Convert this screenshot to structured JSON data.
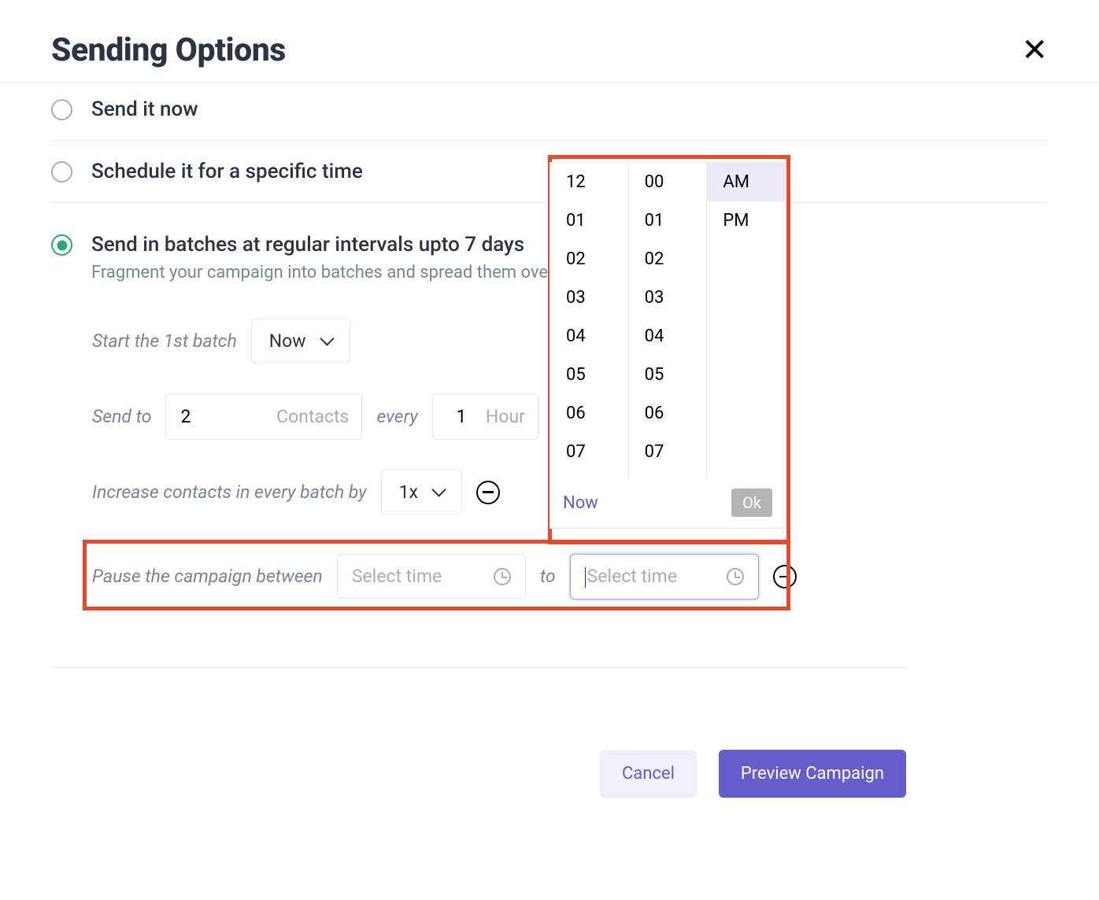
{
  "header": {
    "title": "Sending Options"
  },
  "options": {
    "send_now": "Send it now",
    "schedule": "Schedule it for a specific time",
    "batches": {
      "label": "Send in batches at regular intervals upto 7 days",
      "sub": "Fragment your campaign into batches and spread them over a week to"
    }
  },
  "batch": {
    "start_label": "Start the 1st batch",
    "start_value": "Now",
    "send_to_label": "Send to",
    "send_to_value": "2",
    "send_to_unit": "Contacts",
    "every_label": "every",
    "every_value": "1",
    "every_unit": "Hour",
    "increase_label": "Increase contacts in every batch by",
    "increase_value": "1x",
    "pause_label": "Pause the campaign between",
    "pause_placeholder": "Select time",
    "to_label": "to"
  },
  "time_picker": {
    "hours": [
      "12",
      "01",
      "02",
      "03",
      "04",
      "05",
      "06",
      "07"
    ],
    "minutes": [
      "00",
      "01",
      "02",
      "03",
      "04",
      "05",
      "06",
      "07"
    ],
    "ampm": [
      "AM",
      "PM"
    ],
    "selected_ampm": "AM",
    "now": "Now",
    "ok": "Ok"
  },
  "footer": {
    "cancel": "Cancel",
    "preview": "Preview Campaign"
  }
}
